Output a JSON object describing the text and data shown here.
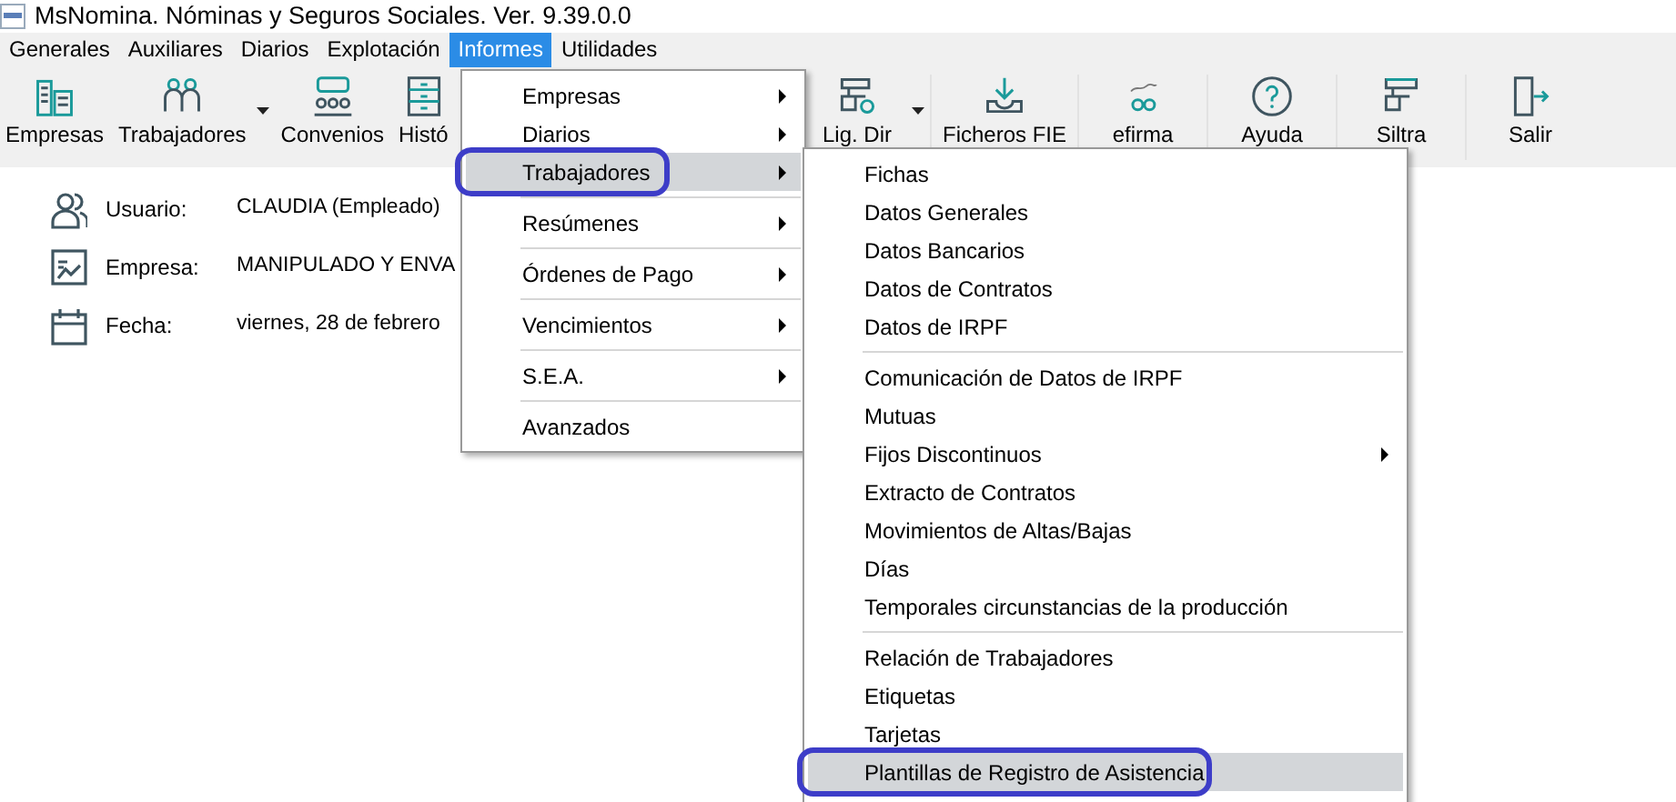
{
  "window": {
    "title": "MsNomina. Nóminas y Seguros Sociales. Ver. 9.39.0.0"
  },
  "menu_bar": [
    {
      "label": "Generales",
      "selected": false
    },
    {
      "label": "Auxiliares",
      "selected": false
    },
    {
      "label": "Diarios",
      "selected": false
    },
    {
      "label": "Explotación",
      "selected": false
    },
    {
      "label": "Informes",
      "selected": true
    },
    {
      "label": "Utilidades",
      "selected": false
    }
  ],
  "toolbar": {
    "left": [
      {
        "label": "Empresas",
        "dropdown": false
      },
      {
        "label": "Trabajadores",
        "dropdown": true
      },
      {
        "label": "Convenios",
        "dropdown": false
      },
      {
        "label": "Histó",
        "dropdown": false
      }
    ],
    "right": [
      {
        "label": "Lig. Dir",
        "dropdown": true
      },
      {
        "label": "Ficheros FIE",
        "dropdown": false
      },
      {
        "label": "efirma",
        "dropdown": false
      },
      {
        "label": "Ayuda",
        "dropdown": false
      },
      {
        "label": "Siltra",
        "dropdown": false
      },
      {
        "label": "Salir",
        "dropdown": false
      }
    ]
  },
  "info": [
    {
      "label": "Usuario:",
      "value": "CLAUDIA (Empleado)"
    },
    {
      "label": "Empresa:",
      "value": "MANIPULADO Y ENVA"
    },
    {
      "label": "Fecha:",
      "value": "viernes, 28 de febrero"
    }
  ],
  "informes_menu": [
    {
      "kind": "item",
      "label": "Empresas",
      "submenu": true,
      "selected": false
    },
    {
      "kind": "item",
      "label": "Diarios",
      "submenu": true,
      "selected": false
    },
    {
      "kind": "item",
      "label": "Trabajadores",
      "submenu": true,
      "selected": true,
      "circled": true
    },
    {
      "kind": "separator"
    },
    {
      "kind": "item",
      "label": "Resúmenes",
      "submenu": true,
      "selected": false
    },
    {
      "kind": "separator"
    },
    {
      "kind": "item",
      "label": "Órdenes de Pago",
      "submenu": true,
      "selected": false
    },
    {
      "kind": "separator"
    },
    {
      "kind": "item",
      "label": "Vencimientos",
      "submenu": true,
      "selected": false
    },
    {
      "kind": "separator"
    },
    {
      "kind": "item",
      "label": "S.E.A.",
      "submenu": true,
      "selected": false
    },
    {
      "kind": "separator"
    },
    {
      "kind": "item",
      "label": "Avanzados",
      "submenu": false,
      "selected": false
    }
  ],
  "trabajadores_submenu": [
    {
      "kind": "item",
      "label": "Fichas",
      "submenu": false,
      "selected": false
    },
    {
      "kind": "item",
      "label": "Datos Generales",
      "submenu": false,
      "selected": false
    },
    {
      "kind": "item",
      "label": "Datos Bancarios",
      "submenu": false,
      "selected": false
    },
    {
      "kind": "item",
      "label": "Datos de Contratos",
      "submenu": false,
      "selected": false
    },
    {
      "kind": "item",
      "label": "Datos de IRPF",
      "submenu": false,
      "selected": false
    },
    {
      "kind": "separator"
    },
    {
      "kind": "item",
      "label": "Comunicación de Datos de IRPF",
      "submenu": false,
      "selected": false
    },
    {
      "kind": "item",
      "label": "Mutuas",
      "submenu": false,
      "selected": false
    },
    {
      "kind": "item",
      "label": "Fijos Discontinuos",
      "submenu": true,
      "selected": false
    },
    {
      "kind": "item",
      "label": "Extracto de Contratos",
      "submenu": false,
      "selected": false
    },
    {
      "kind": "item",
      "label": "Movimientos de Altas/Bajas",
      "submenu": false,
      "selected": false
    },
    {
      "kind": "item",
      "label": "Días",
      "submenu": false,
      "selected": false
    },
    {
      "kind": "item",
      "label": "Temporales circunstancias de la producción",
      "submenu": false,
      "selected": false
    },
    {
      "kind": "separator"
    },
    {
      "kind": "item",
      "label": "Relación de Trabajadores",
      "submenu": false,
      "selected": false
    },
    {
      "kind": "item",
      "label": "Etiquetas",
      "submenu": false,
      "selected": false
    },
    {
      "kind": "item",
      "label": "Tarjetas",
      "submenu": false,
      "selected": false
    },
    {
      "kind": "item",
      "label": "Plantillas de Registro de Asistencia",
      "submenu": false,
      "selected": true,
      "circled": true
    }
  ]
}
